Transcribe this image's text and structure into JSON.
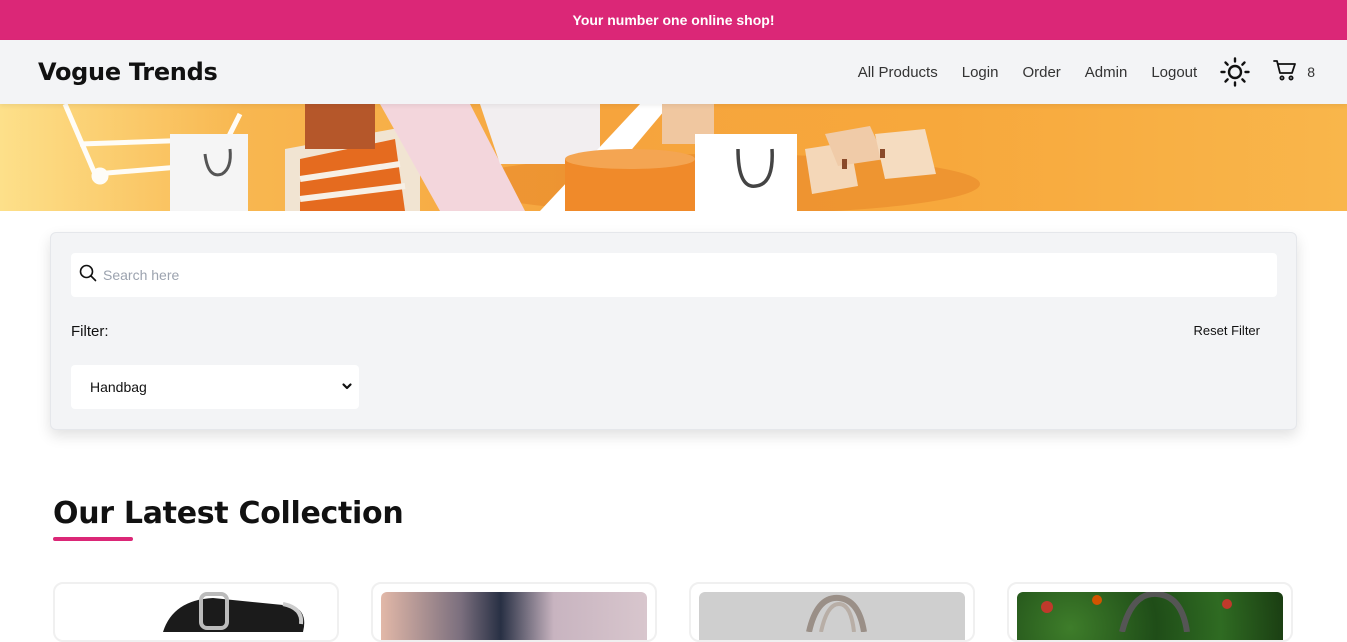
{
  "promo": {
    "text": "Your number one online shop!"
  },
  "nav": {
    "brand": "Vogue Trends",
    "links": [
      "All Products",
      "Login",
      "Order",
      "Admin",
      "Logout"
    ],
    "theme_icon": "sun-icon",
    "cart_icon": "cart-icon",
    "cart_count": "8"
  },
  "filter": {
    "search_placeholder": "Search here",
    "label": "Filter:",
    "reset_label": "Reset Filter",
    "selected_category": "Handbag"
  },
  "collection": {
    "title": "Our Latest Collection"
  },
  "colors": {
    "accent": "#db2777",
    "navbar_bg": "#f3f4f6",
    "banner_orange": "#f6a43d"
  }
}
